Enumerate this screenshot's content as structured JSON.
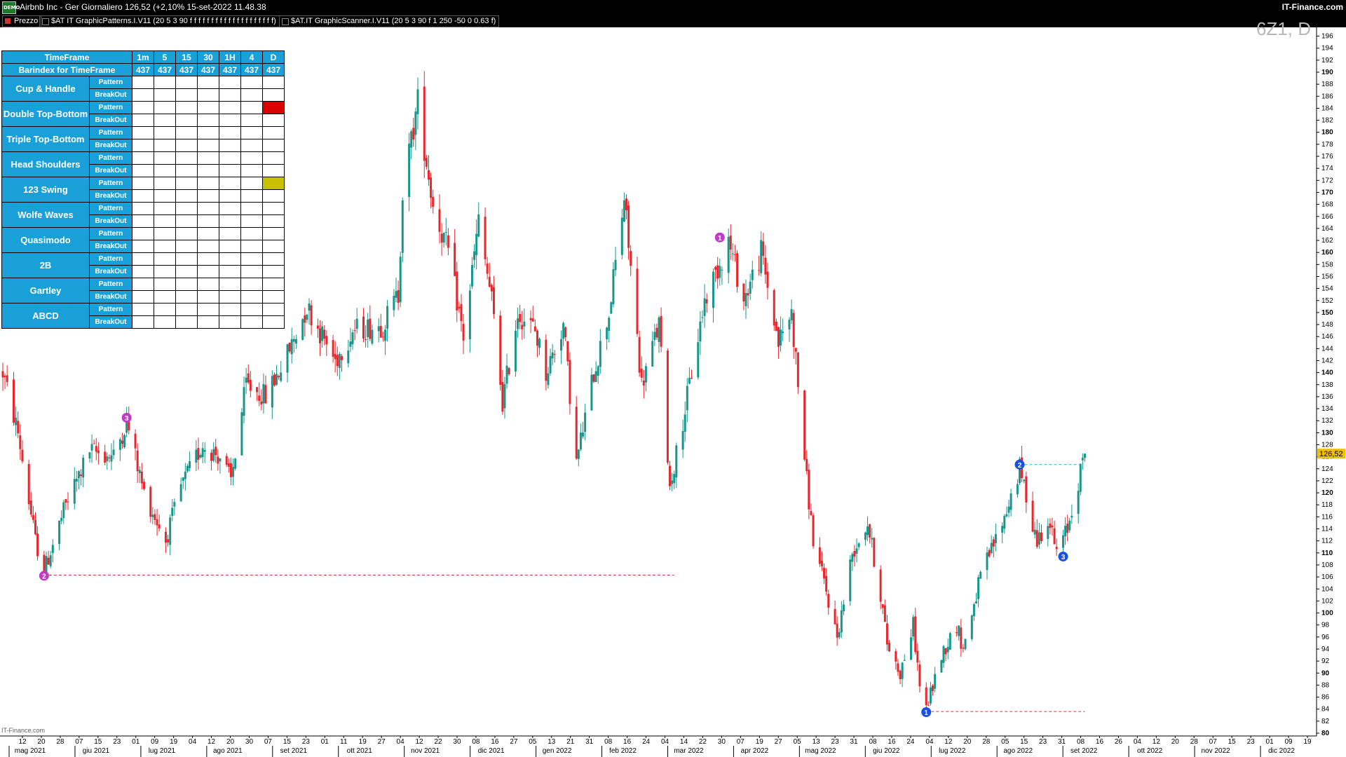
{
  "titlebar": {
    "title": "Airbnb Inc - Ger Giornaliero 126,52 (+2,10% 15-set-2022 11.48.38",
    "brand": "IT-Finance.com",
    "logo_text": "DEMO"
  },
  "indicators": [
    {
      "label": "Prezzo",
      "swatch": "#d83030"
    },
    {
      "label": "$AT IT GraphicPatterns.I.V11 (20 5 3 90 f f f f f f f f f f f f f f f f f f f f)",
      "swatch": "#000000"
    },
    {
      "label": "$AT.IT GraphicScanner.I.V11 (20 5 3 90 f 1 250 -50 0 0.63 f)",
      "swatch": "#000000"
    }
  ],
  "watermark": "6Z1, D",
  "footer": "IT-Finance.com",
  "scanner": {
    "header_label": "TimeFrame",
    "barindex_label": "Barindex for TimeFrame",
    "timeframes": [
      "1m",
      "5",
      "15",
      "30",
      "1H",
      "4",
      "D"
    ],
    "barindex": [
      "437",
      "437",
      "437",
      "437",
      "437",
      "437",
      "437"
    ],
    "pattern_label": "Pattern",
    "breakout_label": "BreakOut",
    "rows": [
      {
        "name": "Cup & Handle",
        "pattern_signals": [
          0,
          0,
          0,
          0,
          0,
          0,
          0
        ],
        "breakout_signals": [
          0,
          0,
          0,
          0,
          0,
          0,
          0
        ]
      },
      {
        "name": "Double Top-Bottom",
        "pattern_signals": [
          0,
          0,
          0,
          0,
          0,
          0,
          "#d80000"
        ],
        "breakout_signals": [
          0,
          0,
          0,
          0,
          0,
          0,
          0
        ]
      },
      {
        "name": "Triple Top-Bottom",
        "pattern_signals": [
          0,
          0,
          0,
          0,
          0,
          0,
          0
        ],
        "breakout_signals": [
          0,
          0,
          0,
          0,
          0,
          0,
          0
        ]
      },
      {
        "name": "Head Shoulders",
        "pattern_signals": [
          0,
          0,
          0,
          0,
          0,
          0,
          0
        ],
        "breakout_signals": [
          0,
          0,
          0,
          0,
          0,
          0,
          0
        ]
      },
      {
        "name": "123 Swing",
        "pattern_signals": [
          0,
          0,
          0,
          0,
          0,
          0,
          "#c8c000"
        ],
        "breakout_signals": [
          0,
          0,
          0,
          0,
          0,
          0,
          0
        ]
      },
      {
        "name": "Wolfe Waves",
        "pattern_signals": [
          0,
          0,
          0,
          0,
          0,
          0,
          0
        ],
        "breakout_signals": [
          0,
          0,
          0,
          0,
          0,
          0,
          0
        ]
      },
      {
        "name": "Quasimodo",
        "pattern_signals": [
          0,
          0,
          0,
          0,
          0,
          0,
          0
        ],
        "breakout_signals": [
          0,
          0,
          0,
          0,
          0,
          0,
          0
        ]
      },
      {
        "name": "2B",
        "pattern_signals": [
          0,
          0,
          0,
          0,
          0,
          0,
          0
        ],
        "breakout_signals": [
          0,
          0,
          0,
          0,
          0,
          0,
          0
        ]
      },
      {
        "name": "Gartley",
        "pattern_signals": [
          0,
          0,
          0,
          0,
          0,
          0,
          0
        ],
        "breakout_signals": [
          0,
          0,
          0,
          0,
          0,
          0,
          0
        ]
      },
      {
        "name": "ABCD",
        "pattern_signals": [
          0,
          0,
          0,
          0,
          0,
          0,
          0
        ],
        "breakout_signals": [
          0,
          0,
          0,
          0,
          0,
          0,
          0
        ]
      }
    ]
  },
  "colors": {
    "up": "#17968c",
    "down": "#e8262c",
    "marker_purple": "#c03cc8",
    "marker_blue": "#1a50e0",
    "price_label_bg": "#f0c000"
  },
  "chart_data": {
    "type": "candlestick",
    "title": "Airbnb Inc - Ger Giornaliero",
    "last_price": "126,52",
    "change": "+2,10%",
    "ylim": [
      80,
      197
    ],
    "y_ticks": [
      80,
      82,
      84,
      86,
      88,
      90,
      92,
      94,
      96,
      98,
      100,
      102,
      104,
      106,
      108,
      110,
      112,
      114,
      116,
      118,
      120,
      122,
      124,
      126,
      128,
      130,
      132,
      134,
      136,
      138,
      140,
      142,
      144,
      146,
      148,
      150,
      152,
      154,
      156,
      158,
      160,
      162,
      164,
      166,
      168,
      170,
      172,
      174,
      176,
      178,
      180,
      182,
      184,
      186,
      188,
      190,
      192,
      194,
      196
    ],
    "y_bold_ticks": [
      80,
      90,
      100,
      110,
      120,
      130,
      140,
      150,
      160,
      170,
      180,
      190
    ],
    "x_tick_labels": [
      "12",
      "20",
      "28",
      "07",
      "15",
      "23",
      "01",
      "09",
      "19",
      "04",
      "12",
      "20",
      "30",
      "07",
      "15",
      "23",
      "01",
      "11",
      "19",
      "27",
      "04",
      "12",
      "22",
      "30",
      "08",
      "16",
      "27",
      "05",
      "13",
      "21",
      "31",
      "08",
      "16",
      "24",
      "04",
      "14",
      "22",
      "30",
      "07",
      "19",
      "27",
      "05",
      "13",
      "23",
      "31",
      "08",
      "16",
      "24",
      "04",
      "12",
      "20",
      "28",
      "05",
      "15",
      "23",
      "31",
      "08",
      "16",
      "26",
      "04",
      "12",
      "20",
      "28",
      "07",
      "15",
      "23",
      "01",
      "09",
      "19"
    ],
    "x_month_labels": [
      "mag 2021",
      "giu 2021",
      "lug 2021",
      "ago 2021",
      "set 2021",
      "ott 2021",
      "nov 2021",
      "dic 2021",
      "gen 2022",
      "feb 2022",
      "mar 2022",
      "apr 2022",
      "mag 2022",
      "giu 2022",
      "lug 2022",
      "ago 2022",
      "set 2022",
      "ott 2022",
      "nov 2022",
      "dic 2022"
    ],
    "x_range": [
      "2021-05-05",
      "2022-12-30"
    ],
    "anchors": [
      [
        "2021-05-05",
        140
      ],
      [
        "2021-05-12",
        130
      ],
      [
        "2021-05-20",
        112
      ],
      [
        "2021-05-24",
        107
      ],
      [
        "2021-06-03",
        118
      ],
      [
        "2021-06-14",
        127
      ],
      [
        "2021-06-25",
        126
      ],
      [
        "2021-07-01",
        132
      ],
      [
        "2021-07-09",
        120
      ],
      [
        "2021-07-19",
        112
      ],
      [
        "2021-07-26",
        121
      ],
      [
        "2021-08-05",
        128
      ],
      [
        "2021-08-13",
        126
      ],
      [
        "2021-08-18",
        122
      ],
      [
        "2021-08-25",
        138
      ],
      [
        "2021-09-03",
        136
      ],
      [
        "2021-09-13",
        143
      ],
      [
        "2021-09-22",
        151
      ],
      [
        "2021-10-05",
        142
      ],
      [
        "2021-10-13",
        147
      ],
      [
        "2021-10-27",
        148
      ],
      [
        "2021-11-03",
        153
      ],
      [
        "2021-11-05",
        170
      ],
      [
        "2021-11-12",
        185
      ],
      [
        "2021-11-19",
        168
      ],
      [
        "2021-11-26",
        160
      ],
      [
        "2021-12-03",
        146
      ],
      [
        "2021-12-10",
        165
      ],
      [
        "2021-12-16",
        152
      ],
      [
        "2021-12-21",
        135
      ],
      [
        "2021-12-28",
        150
      ],
      [
        "2022-01-05",
        147
      ],
      [
        "2022-01-10",
        140
      ],
      [
        "2022-01-18",
        148
      ],
      [
        "2022-01-24",
        125
      ],
      [
        "2022-02-01",
        140
      ],
      [
        "2022-02-08",
        150
      ],
      [
        "2022-02-15",
        169
      ],
      [
        "2022-02-23",
        138
      ],
      [
        "2022-03-03",
        148
      ],
      [
        "2022-03-08",
        121
      ],
      [
        "2022-03-14",
        132
      ],
      [
        "2022-03-24",
        152
      ],
      [
        "2022-04-04",
        162
      ],
      [
        "2022-04-11",
        152
      ],
      [
        "2022-04-19",
        160
      ],
      [
        "2022-04-27",
        145
      ],
      [
        "2022-05-03",
        150
      ],
      [
        "2022-05-06",
        138
      ],
      [
        "2022-05-10",
        122
      ],
      [
        "2022-05-13",
        112
      ],
      [
        "2022-05-18",
        105
      ],
      [
        "2022-05-24",
        96
      ],
      [
        "2022-05-31",
        110
      ],
      [
        "2022-06-07",
        115
      ],
      [
        "2022-06-13",
        103
      ],
      [
        "2022-06-16",
        95
      ],
      [
        "2022-06-22",
        90
      ],
      [
        "2022-06-28",
        98
      ],
      [
        "2022-07-01",
        88
      ],
      [
        "2022-07-04",
        84
      ],
      [
        "2022-07-11",
        93
      ],
      [
        "2022-07-18",
        98
      ],
      [
        "2022-07-21",
        94
      ],
      [
        "2022-07-29",
        106
      ],
      [
        "2022-08-09",
        116
      ],
      [
        "2022-08-16",
        124
      ],
      [
        "2022-08-24",
        112
      ],
      [
        "2022-08-29",
        116
      ],
      [
        "2022-09-02",
        110
      ],
      [
        "2022-09-07",
        114
      ],
      [
        "2022-09-12",
        122
      ],
      [
        "2022-09-15",
        126.52
      ]
    ],
    "annotations": [
      {
        "label": "1",
        "date": "2022-03-31",
        "price": 162.5,
        "color": "#c03cc8"
      },
      {
        "label": "2",
        "date": "2021-05-24",
        "price": 106.2,
        "color": "#c03cc8"
      },
      {
        "label": "3",
        "date": "2021-07-01",
        "price": 132.5,
        "color": "#c03cc8"
      },
      {
        "label": "1",
        "date": "2022-07-04",
        "price": 83.5,
        "color": "#1a50e0"
      },
      {
        "label": "2",
        "date": "2022-08-16",
        "price": 124.7,
        "color": "#1a50e0"
      },
      {
        "label": "3",
        "date": "2022-09-05",
        "price": 109.4,
        "color": "#1a50e0"
      }
    ],
    "lines": [
      {
        "from": "2021-05-24",
        "to": "2022-03-10",
        "price": 106.3,
        "color": "#e03030",
        "style": "dashed"
      },
      {
        "from": "2022-07-04",
        "to": "2022-09-15",
        "price": 83.6,
        "color": "#e03030",
        "style": "dashed"
      },
      {
        "from": "2022-08-16",
        "to": "2022-09-13",
        "price": 124.7,
        "color": "#1ab0d0",
        "style": "dashed"
      }
    ]
  }
}
